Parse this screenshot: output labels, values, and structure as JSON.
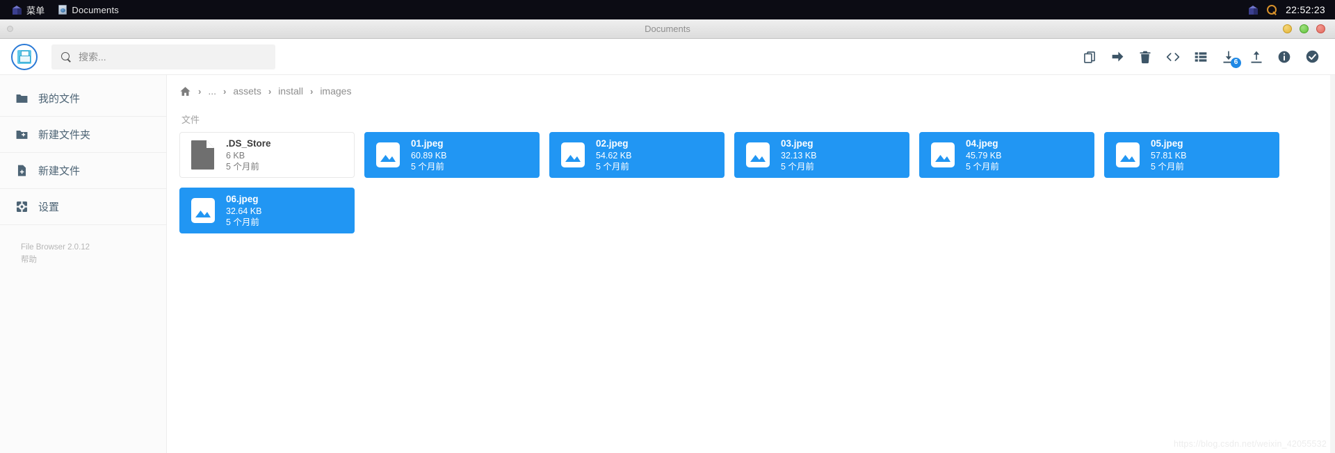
{
  "taskbar": {
    "menu_label": "菜单",
    "menu_icon": "cube-icon",
    "window_entry": {
      "label": "Documents",
      "icon": "document-icon"
    },
    "tray": {
      "cube_icon": "cube-icon",
      "search_icon": "magnifier-icon"
    },
    "clock": "22:52:23"
  },
  "window": {
    "title": "Documents",
    "buttons": {
      "minimize": "minimize-button",
      "maximize": "maximize-button",
      "close": "close-button"
    }
  },
  "header": {
    "logo_icon": "floppy-save-icon",
    "search": {
      "placeholder": "搜索...",
      "value": "",
      "icon": "search-icon"
    },
    "toolbar": [
      {
        "name": "copy-button",
        "icon": "copy-icon",
        "label": "Copy"
      },
      {
        "name": "move-button",
        "icon": "arrow-right-icon",
        "label": "Move"
      },
      {
        "name": "delete-button",
        "icon": "trash-icon",
        "label": "Delete"
      },
      {
        "name": "code-button",
        "icon": "code-icon",
        "label": "Edit"
      },
      {
        "name": "list-view-button",
        "icon": "list-icon",
        "label": "List view"
      },
      {
        "name": "download-button",
        "icon": "download-icon",
        "label": "Download",
        "badge": "6"
      },
      {
        "name": "upload-button",
        "icon": "upload-icon",
        "label": "Upload"
      },
      {
        "name": "info-button",
        "icon": "info-icon",
        "label": "Info"
      },
      {
        "name": "select-all-button",
        "icon": "check-circle-icon",
        "label": "Select all"
      }
    ]
  },
  "sidebar": {
    "items": [
      {
        "label": "我的文件",
        "icon": "folder-icon"
      },
      {
        "label": "新建文件夹",
        "icon": "folder-plus-icon"
      },
      {
        "label": "新建文件",
        "icon": "file-plus-icon"
      },
      {
        "label": "设置",
        "icon": "gear-icon"
      }
    ],
    "footer": {
      "version": "File Browser 2.0.12",
      "help": "帮助"
    }
  },
  "breadcrumb": {
    "home_icon": "home-icon",
    "separator": "›",
    "items": [
      "...",
      "assets",
      "install",
      "images"
    ]
  },
  "files": {
    "section_title": "文件",
    "items": [
      {
        "name": ".DS_Store",
        "size": "6 KB",
        "modified": "5 个月前",
        "icon": "file-icon",
        "selected": false
      },
      {
        "name": "01.jpeg",
        "size": "60.89 KB",
        "modified": "5 个月前",
        "icon": "image-icon",
        "selected": true
      },
      {
        "name": "02.jpeg",
        "size": "54.62 KB",
        "modified": "5 个月前",
        "icon": "image-icon",
        "selected": true
      },
      {
        "name": "03.jpeg",
        "size": "32.13 KB",
        "modified": "5 个月前",
        "icon": "image-icon",
        "selected": true
      },
      {
        "name": "04.jpeg",
        "size": "45.79 KB",
        "modified": "5 个月前",
        "icon": "image-icon",
        "selected": true
      },
      {
        "name": "05.jpeg",
        "size": "57.81 KB",
        "modified": "5 个月前",
        "icon": "image-icon",
        "selected": true
      },
      {
        "name": "06.jpeg",
        "size": "32.64 KB",
        "modified": "5 个月前",
        "icon": "image-icon",
        "selected": true
      }
    ]
  },
  "watermark": "https://blog.csdn.net/weixin_42055532",
  "colors": {
    "accent": "#2196f3",
    "sidebar_text": "#4d6475",
    "taskbar_bg": "#0c0c14"
  }
}
